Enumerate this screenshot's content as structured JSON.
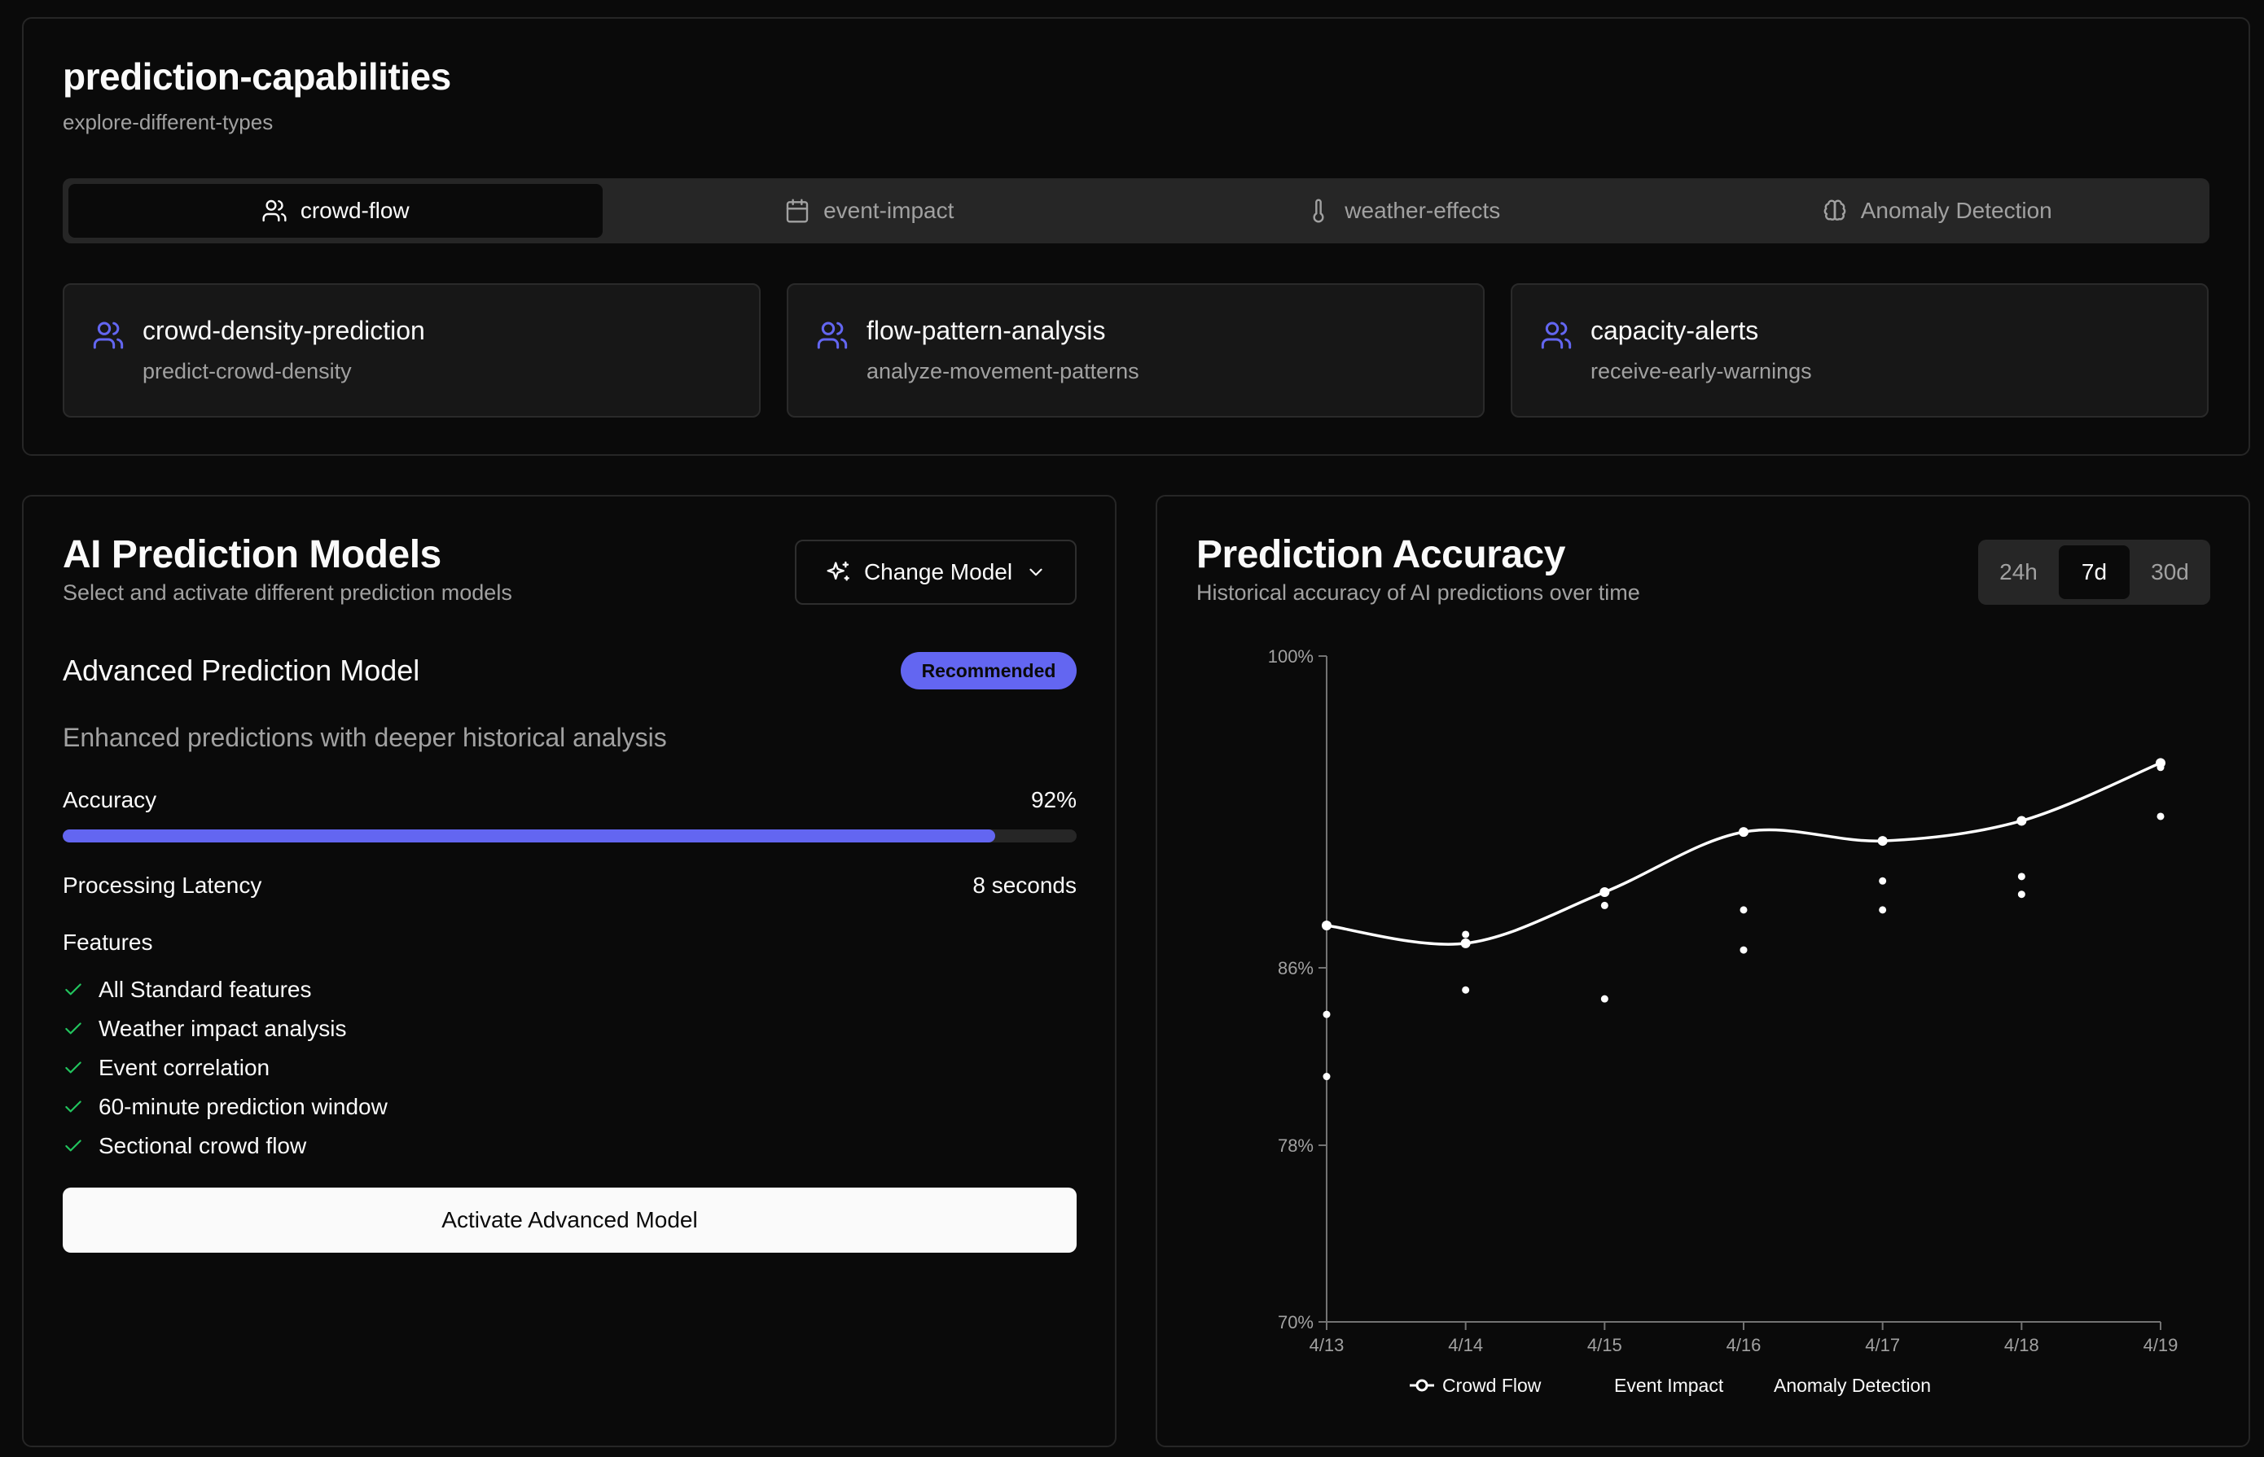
{
  "capabilities": {
    "title": "prediction-capabilities",
    "subtitle": "explore-different-types",
    "tabs": [
      {
        "label": "crowd-flow",
        "icon": "users-icon",
        "active": true
      },
      {
        "label": "event-impact",
        "icon": "calendar-icon",
        "active": false
      },
      {
        "label": "weather-effects",
        "icon": "thermometer-icon",
        "active": false
      },
      {
        "label": "Anomaly Detection",
        "icon": "brain-icon",
        "active": false
      }
    ],
    "features": [
      {
        "title": "crowd-density-prediction",
        "subtitle": "predict-crowd-density",
        "icon": "users-icon"
      },
      {
        "title": "flow-pattern-analysis",
        "subtitle": "analyze-movement-patterns",
        "icon": "users-icon"
      },
      {
        "title": "capacity-alerts",
        "subtitle": "receive-early-warnings",
        "icon": "users-icon"
      }
    ]
  },
  "models": {
    "title": "AI Prediction Models",
    "subtitle": "Select and activate different prediction models",
    "change_button": "Change Model",
    "model_name": "Advanced Prediction Model",
    "badge": "Recommended",
    "description": "Enhanced predictions with deeper historical analysis",
    "accuracy_label": "Accuracy",
    "accuracy_value": "92%",
    "accuracy_fraction": 0.92,
    "latency_label": "Processing Latency",
    "latency_value": "8 seconds",
    "features_heading": "Features",
    "features": [
      "All Standard features",
      "Weather impact analysis",
      "Event correlation",
      "60-minute prediction window",
      "Sectional crowd flow"
    ],
    "activate_button": "Activate Advanced Model"
  },
  "accuracy": {
    "title": "Prediction Accuracy",
    "subtitle": "Historical accuracy of AI predictions over time",
    "ranges": [
      {
        "label": "24h",
        "active": false
      },
      {
        "label": "7d",
        "active": true
      },
      {
        "label": "30d",
        "active": false
      }
    ]
  },
  "colors": {
    "accent": "#6366f1",
    "background": "#0a0a0a",
    "muted_text": "#a1a1a1",
    "success": "#22c55e"
  },
  "chart_data": {
    "type": "line",
    "categories": [
      "4/13",
      "4/14",
      "4/15",
      "4/16",
      "4/17",
      "4/18",
      "4/19"
    ],
    "y_ticks": [
      "100%",
      "86%",
      "78%",
      "70%"
    ],
    "y_tick_values": [
      100,
      86,
      78,
      70
    ],
    "ylim": [
      70,
      100
    ],
    "series": [
      {
        "name": "Crowd Flow",
        "values": [
          87.9,
          87.1,
          89.4,
          92.1,
          91.7,
          92.6,
          95.2
        ]
      },
      {
        "name": "Event Impact",
        "values": [
          83.9,
          87.5,
          88.8,
          88.6,
          89.9,
          90.1,
          95.0
        ]
      },
      {
        "name": "Anomaly Detection",
        "values": [
          81.1,
          85.0,
          84.6,
          86.8,
          88.6,
          89.3,
          92.8
        ]
      }
    ],
    "legend_position": "bottom"
  }
}
